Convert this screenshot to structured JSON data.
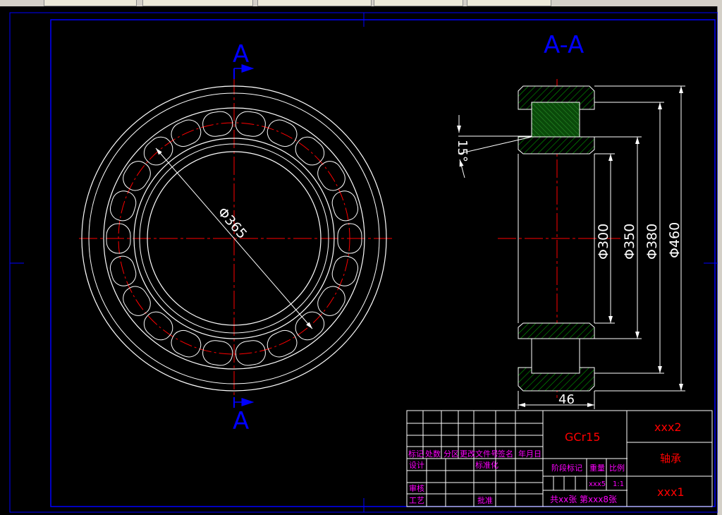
{
  "section_labels": {
    "cut_top": "A",
    "cut_bottom": "A",
    "section_title": "A-A"
  },
  "dimensions": {
    "pitch_diameter": "Φ365",
    "angle": "15°",
    "bore": "Φ300",
    "inner_race": "Φ350",
    "outer_race": "Φ380",
    "outer_diameter": "Φ460",
    "width": "46"
  },
  "title_block": {
    "material": "GCr15",
    "drawing_code": "xxx2",
    "part_name": "轴承",
    "company": "xxx1",
    "headers": {
      "mark": "标记",
      "count": "处数",
      "zone": "分区",
      "change_doc": "更改文件号",
      "sign": "签名",
      "date": "年月日"
    },
    "rows": {
      "design": "设计",
      "standardize": "标准化",
      "review": "审核",
      "process": "工艺",
      "approve": "批准"
    },
    "stage_mark": "阶段标记",
    "weight": "重量",
    "scale": "比例",
    "weight_value": "xxx5",
    "scale_value": "1:1",
    "sheets": "共xx张 第xxx8张"
  },
  "colors": {
    "background": "#000000",
    "outline": "#ffffff",
    "centerline": "#ff0000",
    "section_label": "#0000ff",
    "title_text": "#ff0000",
    "title_labels": "#ff00ff",
    "hatch": "#00aa00"
  }
}
